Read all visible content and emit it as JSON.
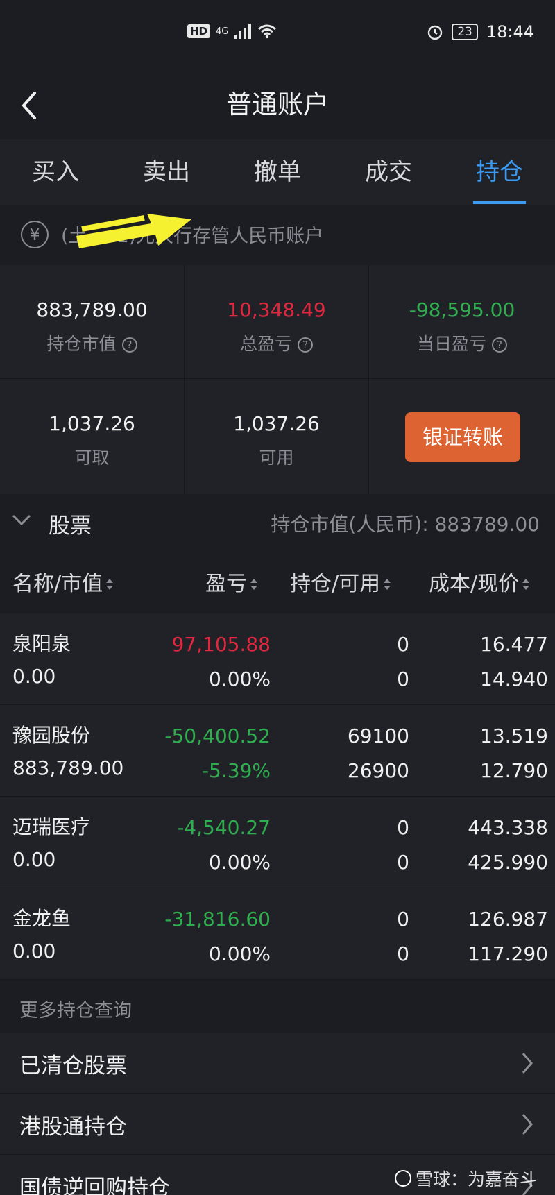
{
  "status_bar": {
    "hd": "HD",
    "network": "4G",
    "battery": "23",
    "time": "18:44"
  },
  "nav": {
    "title": "普通账户"
  },
  "tabs": [
    {
      "label": "买入"
    },
    {
      "label": "卖出"
    },
    {
      "label": "撤单"
    },
    {
      "label": "成交"
    },
    {
      "label": "持仓",
      "active": true
    }
  ],
  "account": {
    "text": "(土    ....1)光大行存管人民币账户"
  },
  "stats": {
    "market_value": {
      "value": "883,789.00",
      "label": "持仓市值"
    },
    "total_pnl": {
      "value": "10,348.49",
      "label": "总盈亏"
    },
    "daily_pnl": {
      "value": "-98,595.00",
      "label": "当日盈亏"
    },
    "withdrawable": {
      "value": "1,037.26",
      "label": "可取"
    },
    "available": {
      "value": "1,037.26",
      "label": "可用"
    },
    "transfer_button": "银证转账"
  },
  "section": {
    "title": "股票",
    "summary": "持仓市值(人民币): 883789.00"
  },
  "columns": {
    "name": "名称/市值",
    "pnl": "盈亏",
    "holding": "持仓/可用",
    "cost": "成本/现价"
  },
  "holdings": [
    {
      "name": "泉阳泉",
      "market_value": "0.00",
      "pnl": "97,105.88",
      "pnl_pct": "0.00%",
      "pnl_color": "red",
      "holding": "0",
      "available": "0",
      "cost": "16.477",
      "price": "14.940",
      "pct_color": "white"
    },
    {
      "name": "豫园股份",
      "market_value": "883,789.00",
      "pnl": "-50,400.52",
      "pnl_pct": "-5.39%",
      "pnl_color": "green",
      "holding": "69100",
      "available": "26900",
      "cost": "13.519",
      "price": "12.790",
      "pct_color": "green"
    },
    {
      "name": "迈瑞医疗",
      "market_value": "0.00",
      "pnl": "-4,540.27",
      "pnl_pct": "0.00%",
      "pnl_color": "green",
      "holding": "0",
      "available": "0",
      "cost": "443.338",
      "price": "425.990",
      "pct_color": "white"
    },
    {
      "name": "金龙鱼",
      "market_value": "0.00",
      "pnl": "-31,816.60",
      "pnl_pct": "0.00%",
      "pnl_color": "green",
      "holding": "0",
      "available": "0",
      "cost": "126.987",
      "price": "117.290",
      "pct_color": "white"
    }
  ],
  "more": {
    "title": "更多持仓查询",
    "items": [
      {
        "label": "已清仓股票"
      },
      {
        "label": "港股通持仓"
      },
      {
        "label": "国债逆回购持仓"
      }
    ]
  },
  "watermark": {
    "text": "雪球：为嘉奋斗"
  },
  "colors": {
    "accent": "#3b9bf2",
    "up": "#e0273d",
    "down": "#2fae4e",
    "button": "#de6332",
    "annotation_arrow": "#f5f030"
  }
}
